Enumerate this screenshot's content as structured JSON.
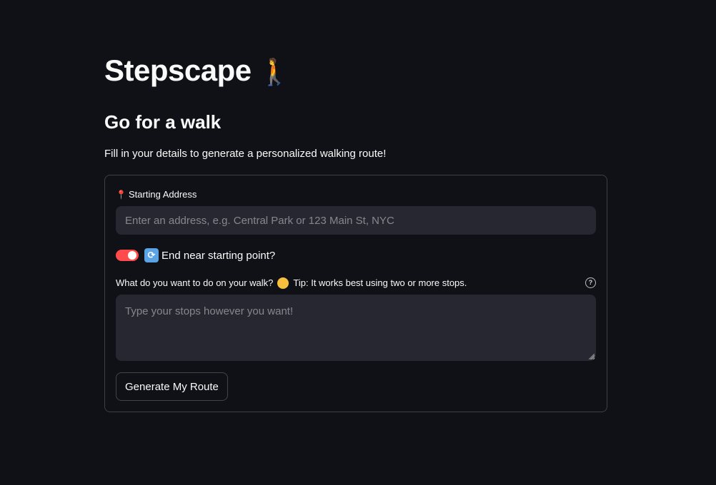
{
  "app": {
    "title": "Stepscape",
    "title_emoji": "🚶"
  },
  "page": {
    "subheader": "Go for a walk",
    "intro": "Fill in your details to generate a personalized walking route!"
  },
  "form": {
    "address": {
      "icon": "📍",
      "label": "Starting Address",
      "value": "",
      "placeholder": "Enter an address, e.g. Central Park or 123 Main St, NYC"
    },
    "loop_toggle": {
      "checked": true,
      "icon": "🔁",
      "label": "End near starting point?"
    },
    "stops": {
      "label_prefix": "What do you want to do on your walk?",
      "label_emoji": "🤔",
      "label_tip": "Tip: It works best using two or more stops.",
      "help_icon": "?",
      "value": "",
      "placeholder": "Type your stops however you want!"
    },
    "submit_label": "Generate My Route"
  },
  "colors": {
    "background": "#0f1116",
    "input_bg": "#262730",
    "accent": "#ff4b4b",
    "text": "#fafafa"
  }
}
